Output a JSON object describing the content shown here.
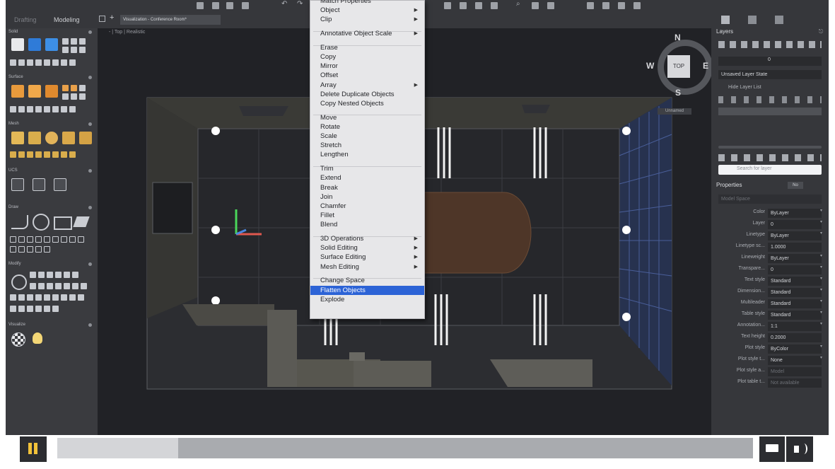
{
  "app": {
    "workspace_tabs": [
      "Drafting",
      "Modeling"
    ],
    "document_tab": "Visualization - Conference Room*",
    "viewport_label": "- | Top | Realistic"
  },
  "left_palette": {
    "sections": [
      "Solid",
      "Surface",
      "Mesh",
      "UCS",
      "Draw",
      "Modify",
      "Visualize"
    ]
  },
  "viewcube": {
    "north": "N",
    "south": "S",
    "east": "E",
    "west": "W",
    "face": "TOP",
    "ucs_label": "Unnamed"
  },
  "context_menu": {
    "items": [
      {
        "label": "Match Properties",
        "sub": false
      },
      {
        "label": "Object",
        "sub": true
      },
      {
        "label": "Clip",
        "sub": true
      },
      {
        "sep": true
      },
      {
        "label": "Annotative Object Scale",
        "sub": true
      },
      {
        "sep": true
      },
      {
        "label": "Erase",
        "sub": false
      },
      {
        "label": "Copy",
        "sub": false
      },
      {
        "label": "Mirror",
        "sub": false
      },
      {
        "label": "Offset",
        "sub": false
      },
      {
        "label": "Array",
        "sub": true
      },
      {
        "label": "Delete Duplicate Objects",
        "sub": false
      },
      {
        "label": "Copy Nested Objects",
        "sub": false
      },
      {
        "sep": true
      },
      {
        "label": "Move",
        "sub": false
      },
      {
        "label": "Rotate",
        "sub": false
      },
      {
        "label": "Scale",
        "sub": false
      },
      {
        "label": "Stretch",
        "sub": false
      },
      {
        "label": "Lengthen",
        "sub": false
      },
      {
        "sep": true
      },
      {
        "label": "Trim",
        "sub": false
      },
      {
        "label": "Extend",
        "sub": false
      },
      {
        "label": "Break",
        "sub": false
      },
      {
        "label": "Join",
        "sub": false
      },
      {
        "label": "Chamfer",
        "sub": false
      },
      {
        "label": "Fillet",
        "sub": false
      },
      {
        "label": "Blend",
        "sub": false
      },
      {
        "sep": true
      },
      {
        "label": "3D Operations",
        "sub": true
      },
      {
        "label": "Solid Editing",
        "sub": true
      },
      {
        "label": "Surface Editing",
        "sub": true
      },
      {
        "label": "Mesh Editing",
        "sub": true
      },
      {
        "sep": true
      },
      {
        "label": "Change Space",
        "sub": false
      },
      {
        "label": "Flatten Objects",
        "sub": false,
        "selected": true
      },
      {
        "label": "Explode",
        "sub": false
      }
    ]
  },
  "layers_panel": {
    "title": "Layers",
    "current_layer": "0",
    "layer_state": "Unsaved Layer State",
    "hide_layer_list": "Hide Layer List",
    "search_placeholder": "Search for layer"
  },
  "properties_panel": {
    "title": "Properties",
    "no_label": "No",
    "space": "Model Space",
    "rows": [
      {
        "label": "Color",
        "value": "ByLayer"
      },
      {
        "label": "Layer",
        "value": "0"
      },
      {
        "label": "Linetype",
        "value": "ByLayer"
      },
      {
        "label": "Linetype sc...",
        "value": "1.0000"
      },
      {
        "label": "Lineweight",
        "value": "ByLayer"
      },
      {
        "label": "Transpare...",
        "value": "0"
      },
      {
        "label": "Text style",
        "value": "Standard"
      },
      {
        "label": "Dimension...",
        "value": "Standard"
      },
      {
        "label": "Multileader",
        "value": "Standard"
      },
      {
        "label": "Table style",
        "value": "Standard"
      },
      {
        "label": "Annotation...",
        "value": "1:1"
      },
      {
        "label": "Text height",
        "value": "0.2000"
      },
      {
        "label": "Plot style",
        "value": "ByColor"
      },
      {
        "label": "Plot style t...",
        "value": "None"
      },
      {
        "label": "Plot style a...",
        "value": "Model"
      },
      {
        "label": "Plot table t...",
        "value": "Not available"
      }
    ]
  },
  "player": {
    "progress": 0.174
  },
  "colors": {
    "menu_highlight": "#2c63d6",
    "viewport_bg": "#212226",
    "table_top": "#4e3628"
  }
}
